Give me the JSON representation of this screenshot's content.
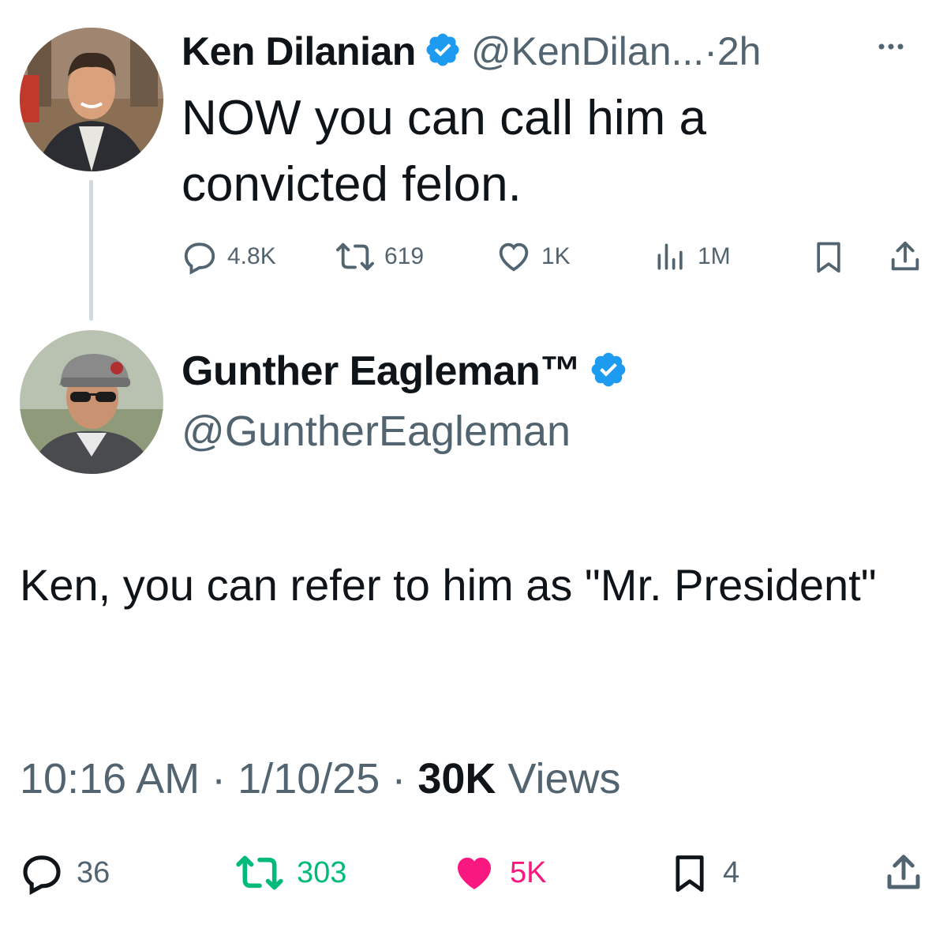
{
  "parent_tweet": {
    "author_name": "Ken Dilanian",
    "handle": "@KenDilan...",
    "separator": "·",
    "time_ago": "2h",
    "text": "NOW you can call him a convicted felon.",
    "stats": {
      "replies": "4.8K",
      "reposts": "619",
      "likes": "1K",
      "views": "1M"
    },
    "icons": [
      "more-icon",
      "reply-icon",
      "repost-icon",
      "like-icon",
      "views-icon",
      "bookmark-icon",
      "share-icon"
    ]
  },
  "reply_tweet": {
    "author_name": "Gunther Eagleman™",
    "handle": "@GuntherEagleman",
    "text": "Ken,  you can refer to him as \"Mr. President\"",
    "time": "10:16 AM",
    "date": "1/10/25",
    "views_count": "30K",
    "views_label": "Views",
    "stats": {
      "replies": "36",
      "reposts": "303",
      "likes": "5K",
      "bookmarks": "4"
    }
  },
  "colors": {
    "text_primary": "#0f1419",
    "text_secondary": "#536471",
    "verified_blue": "#1d9bf0",
    "repost_green": "#00ba7c",
    "like_pink": "#f91880",
    "thread_line": "#cfd9de"
  }
}
